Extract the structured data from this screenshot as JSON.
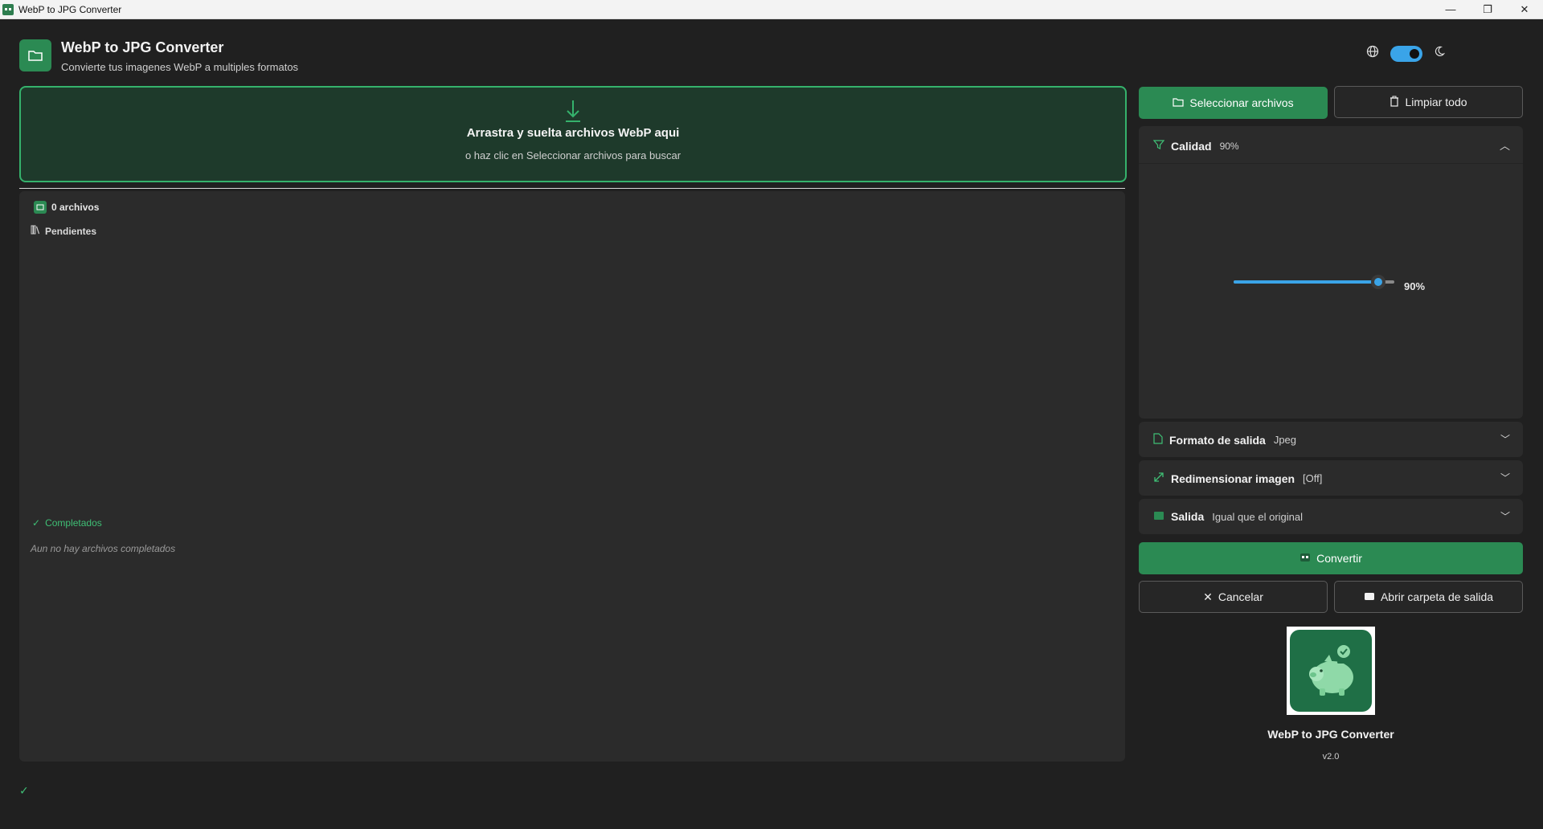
{
  "window": {
    "title": "WebP to JPG Converter",
    "controls": {
      "minimize": "—",
      "maximize": "❐",
      "close": "✕"
    }
  },
  "header": {
    "title": "WebP to JPG Converter",
    "subtitle": "Convierte tus imagenes WebP a multiples formatos",
    "icon": "folder-icon",
    "theme_toggle_on": true
  },
  "dropzone": {
    "title": "Arrastra y suelta archivos WebP aqui",
    "subtitle": "o haz clic en Seleccionar archivos para buscar",
    "icon": "download-arrow-icon"
  },
  "filelist": {
    "count_label": "0 archivos",
    "pending_label": "Pendientes",
    "completed_label": "Completados",
    "empty_completed": "Aun no hay archivos completados"
  },
  "actions": {
    "select_files": "Seleccionar archivos",
    "clear_all": "Limpiar todo",
    "convert": "Convertir",
    "cancel": "Cancelar",
    "open_output": "Abrir carpeta de salida"
  },
  "settings": {
    "quality": {
      "label": "Calidad",
      "value": "90%",
      "slider_value": 90,
      "slider_display": "90%"
    },
    "format": {
      "label": "Formato de salida",
      "value": "Jpeg"
    },
    "resize": {
      "label": "Redimensionar imagen",
      "value": "[Off]"
    },
    "output": {
      "label": "Salida",
      "value": "Igual que el original"
    }
  },
  "about": {
    "name": "WebP to JPG Converter",
    "version": "v2.0"
  },
  "colors": {
    "accent_green": "#2b8a53",
    "dropzone_border": "#35b26c",
    "slider_blue": "#3aa4e8"
  }
}
